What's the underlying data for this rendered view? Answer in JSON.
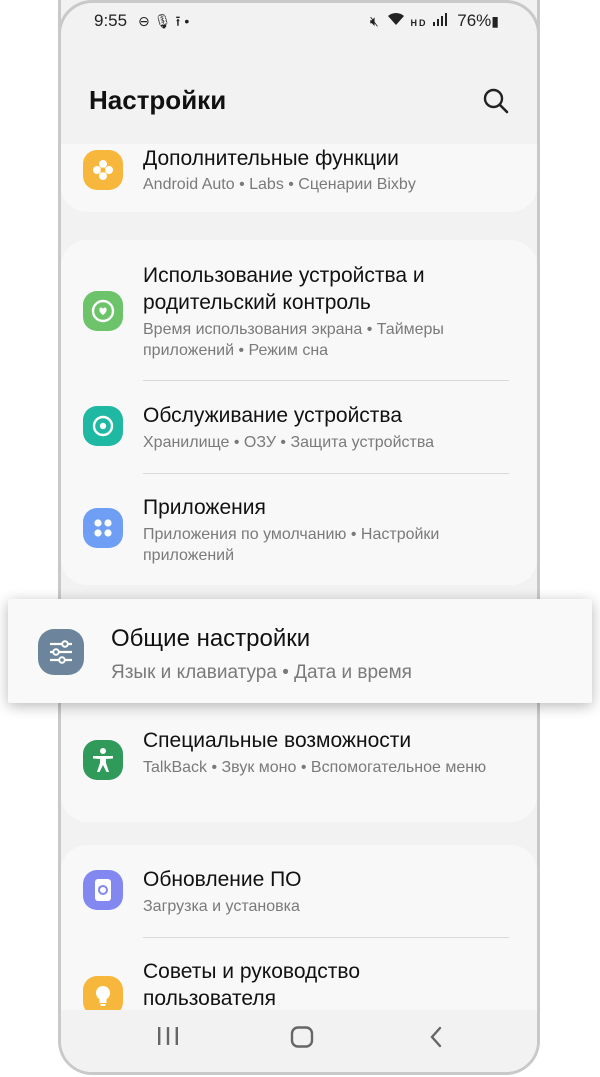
{
  "status_bar": {
    "time": "9:55",
    "left_icons": [
      "do-not-disturb-icon",
      "mic-icon",
      "upload-icon",
      "dot-icon"
    ],
    "right_icons": [
      "mute-icon",
      "wifi-icon",
      "hd-voice-icon",
      "signal-icon"
    ],
    "battery_text": "76%"
  },
  "header": {
    "title": "Настройки"
  },
  "colors": {
    "advanced": "#f6b73c",
    "digital_wellbeing": "#6cc36a",
    "device_care": "#1eb8a3",
    "apps": "#6f9ff5",
    "general": "#6c859c",
    "accessibility": "#2f9a5a",
    "software_update": "#8288f0",
    "tips": "#f6b73c"
  },
  "items": {
    "advanced": {
      "title": "Дополнительные функции",
      "sub": "Android Auto  •  Labs  •  Сценарии Bixby"
    },
    "wellbeing": {
      "title": "Использование устройства и родительский контроль",
      "sub": "Время использования экрана  •  Таймеры приложений  •  Режим сна"
    },
    "device_care": {
      "title": "Обслуживание устройства",
      "sub": "Хранилище  •  ОЗУ  •  Защита устройства"
    },
    "apps": {
      "title": "Приложения",
      "sub": "Приложения по умолчанию  •  Настройки приложений"
    },
    "general": {
      "title": "Общие настройки",
      "sub": "Язык и клавиатура  •  Дата и время"
    },
    "accessibility": {
      "title": "Специальные возможности",
      "sub": "TalkBack  •  Звук моно  •  Вспомогательное меню"
    },
    "software_update": {
      "title": "Обновление ПО",
      "sub": "Загрузка и установка"
    },
    "tips": {
      "title": "Советы и руководство пользователя",
      "sub": ""
    }
  }
}
